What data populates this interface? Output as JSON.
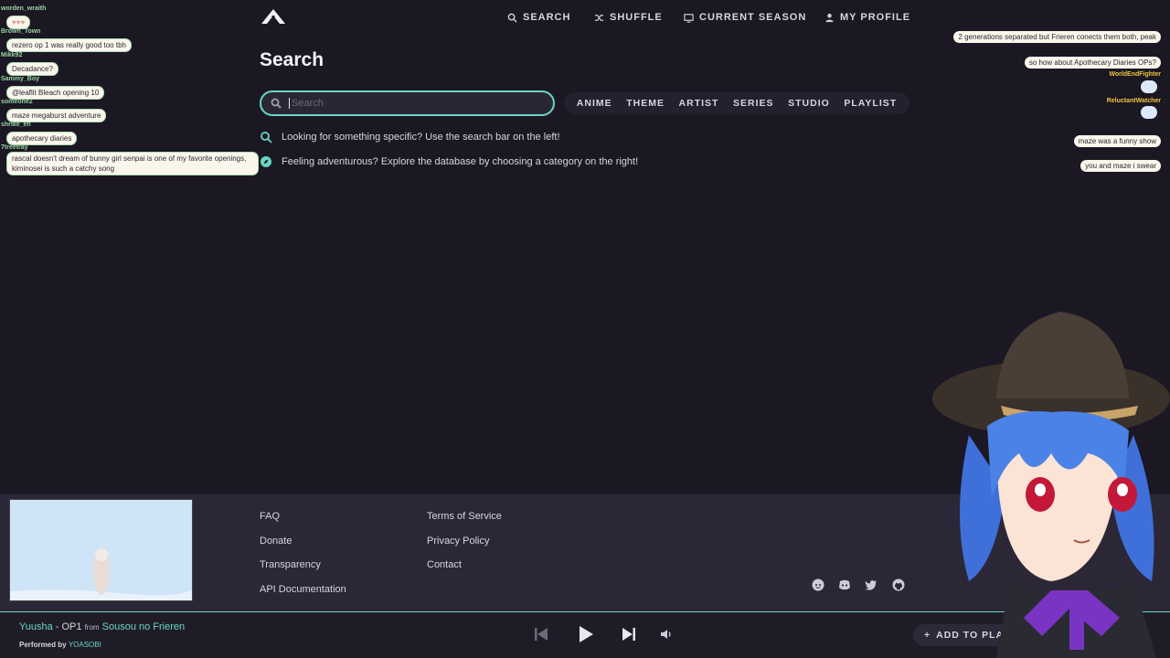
{
  "nav": {
    "search": "SEARCH",
    "shuffle": "SHUFFLE",
    "current_season": "CURRENT SEASON",
    "my_profile": "MY PROFILE"
  },
  "page": {
    "title": "Search"
  },
  "search": {
    "placeholder": "Search"
  },
  "categories": [
    "ANIME",
    "THEME",
    "ARTIST",
    "SERIES",
    "STUDIO",
    "PLAYLIST"
  ],
  "hints": [
    "Looking for something specific? Use the search bar on the left!",
    "Feeling adventurous? Explore the database by choosing a category on the right!"
  ],
  "chat_left": [
    {
      "user": "worden_wraith",
      "text": ""
    },
    {
      "user": "Brown_Town",
      "text": "rezero op 1 was really good too tbh"
    },
    {
      "user": "Mikk92",
      "text": "Decadance?"
    },
    {
      "user": "Sammy_Boy",
      "text": "@leaflit Bleach opening 10"
    },
    {
      "user": "someone2",
      "text": "maze megaburst adventure"
    },
    {
      "user": "shrike_en",
      "text": "apothecary diaries"
    },
    {
      "user": "7treetray",
      "text": "rascal doesn't dream of bunny girl senpai is one of my favorite openings, kiminosei is such a catchy song"
    }
  ],
  "chat_right": [
    {
      "user": "",
      "text": "2 generations separated but Frieren conects them both, peak"
    },
    {
      "user": "",
      "text": "so how about Apothecary Diaries OPs?"
    },
    {
      "user": "WorldEndFighter",
      "text": ""
    },
    {
      "user": "ReluctantWatcher",
      "text": ""
    },
    {
      "user": "",
      "text": "maze was a funny show"
    },
    {
      "user": "",
      "text": "you and maze i swear"
    }
  ],
  "footer": {
    "col1": [
      "FAQ",
      "Donate",
      "Transparency",
      "API Documentation"
    ],
    "col2": [
      "Terms of Service",
      "Privacy Policy",
      "Contact"
    ]
  },
  "now_playing": {
    "song": "Yuusha",
    "theme": "OP1",
    "from_label": "from",
    "anime": "Sousou no Frieren",
    "performed_by_label": "Performed by",
    "artist": "YOASOBI"
  },
  "player": {
    "add_to_playlist": "ADD TO PLAYLIST"
  },
  "colors": {
    "accent": "#6ad6c4",
    "background": "#1b1824",
    "footer": "#2b2737"
  }
}
